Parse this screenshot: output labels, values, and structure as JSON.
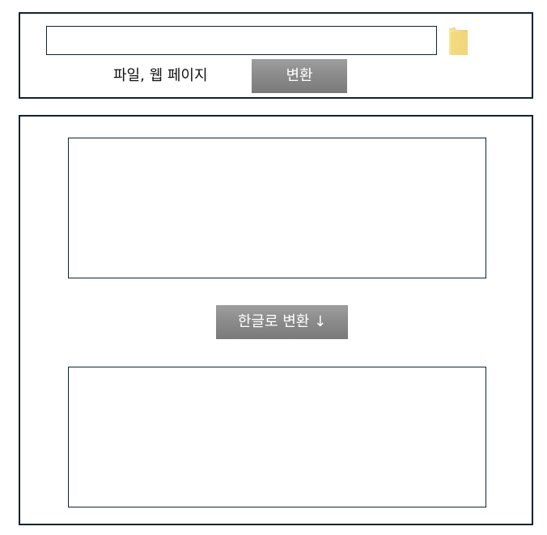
{
  "top": {
    "url_input": {
      "value": "",
      "placeholder": ""
    },
    "source_label": "파일, 웹 페이지",
    "convert_label": "변환",
    "icons": {
      "folder": "folder-icon"
    },
    "colors": {
      "folder_light": "#f7dc86",
      "folder_dark": "#e8c45c"
    }
  },
  "main": {
    "source_text": {
      "value": "",
      "placeholder": ""
    },
    "to_korean_label": "한글로 변환 ↓",
    "result_text": {
      "value": "",
      "placeholder": ""
    }
  },
  "colors": {
    "border": "#0f2430",
    "button_gray": "#8a8a8a",
    "button_text": "#ffffff"
  }
}
